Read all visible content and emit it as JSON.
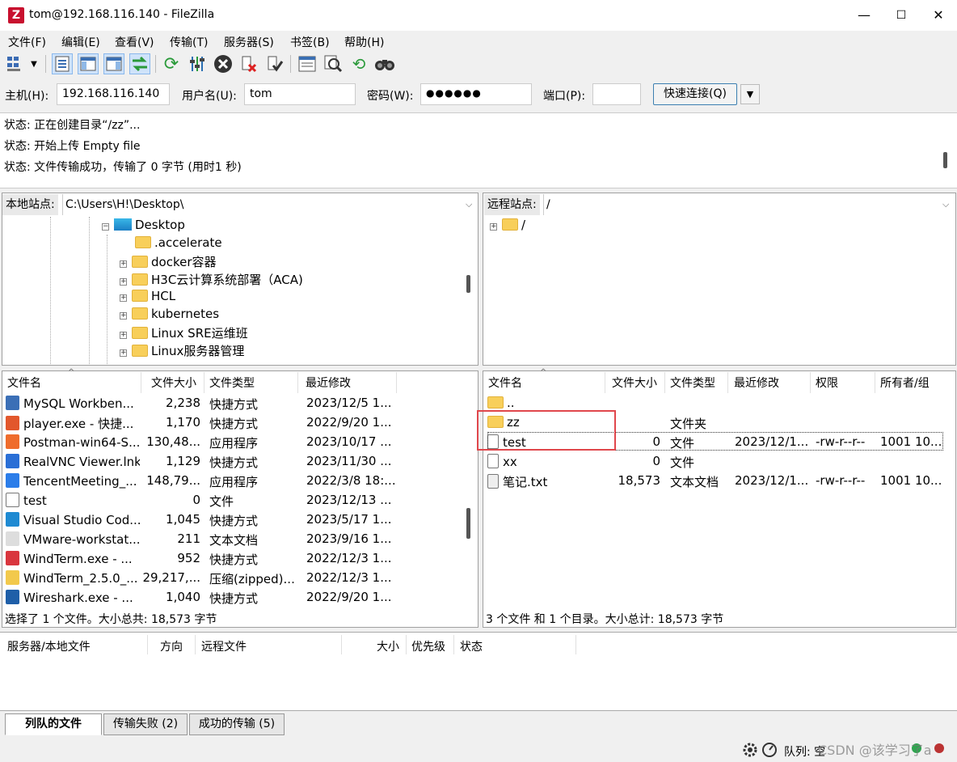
{
  "window": {
    "title": "tom@192.168.116.140 - FileZilla",
    "app_icon_letter": "Z",
    "minimize": "—",
    "maximize": "☐",
    "close": "✕"
  },
  "menu": [
    "文件(F)",
    "编辑(E)",
    "查看(V)",
    "传输(T)",
    "服务器(S)",
    "书签(B)",
    "帮助(H)"
  ],
  "quickconnect": {
    "host_label": "主机(H):",
    "host_value": "192.168.116.140",
    "user_label": "用户名(U):",
    "user_value": "tom",
    "pass_label": "密码(W):",
    "pass_value": "●●●●●●",
    "port_label": "端口(P):",
    "port_value": "",
    "connect_button": "快速连接(Q)",
    "dropdown": "▼"
  },
  "log": [
    "状态:  正在创建目录“/zz”...",
    "状态:  开始上传 Empty file",
    "状态:  文件传输成功，传输了 0 字节 (用时1 秒)"
  ],
  "local": {
    "site_label": "本地站点:",
    "path": "C:\\Users\\H!\\Desktop\\",
    "tree": [
      {
        "name": "Desktop",
        "type": "desktop",
        "expander": "−"
      },
      {
        "name": ".accelerate",
        "type": "folder",
        "expander": ""
      },
      {
        "name": "docker容器",
        "type": "folder",
        "expander": "+"
      },
      {
        "name": "H3C云计算系统部署（ACA)",
        "type": "folder",
        "expander": "+"
      },
      {
        "name": "HCL",
        "type": "folder",
        "expander": "+"
      },
      {
        "name": "kubernetes",
        "type": "folder",
        "expander": "+"
      },
      {
        "name": "Linux SRE运维班",
        "type": "folder",
        "expander": "+"
      },
      {
        "name": "Linux服务器管理",
        "type": "folder",
        "expander": "+"
      }
    ],
    "columns": [
      "文件名",
      "文件大小",
      "文件类型",
      "最近修改"
    ],
    "files": [
      {
        "name": "MySQL Workben...",
        "size": "2,238",
        "type": "快捷方式",
        "modified": "2023/12/5 1...",
        "icon": "#3b6fb6"
      },
      {
        "name": "player.exe - 快捷...",
        "size": "1,170",
        "type": "快捷方式",
        "modified": "2022/9/20 1...",
        "icon": "#e2572c"
      },
      {
        "name": "Postman-win64-S...",
        "size": "130,48...",
        "type": "应用程序",
        "modified": "2023/10/17 ...",
        "icon": "#ef6c2c"
      },
      {
        "name": "RealVNC Viewer.lnk",
        "size": "1,129",
        "type": "快捷方式",
        "modified": "2023/11/30 ...",
        "icon": "#2a6fd6"
      },
      {
        "name": "TencentMeeting_...",
        "size": "148,79...",
        "type": "应用程序",
        "modified": "2022/3/8 18:...",
        "icon": "#2b7de9"
      },
      {
        "name": "test",
        "size": "0",
        "type": "文件",
        "modified": "2023/12/13 ...",
        "icon": "#ffffff"
      },
      {
        "name": "Visual Studio Cod...",
        "size": "1,045",
        "type": "快捷方式",
        "modified": "2023/5/17 1...",
        "icon": "#1f8ad2"
      },
      {
        "name": "VMware-workstat...",
        "size": "211",
        "type": "文本文档",
        "modified": "2023/9/16 1...",
        "icon": "#dddddd"
      },
      {
        "name": "WindTerm.exe - ...",
        "size": "952",
        "type": "快捷方式",
        "modified": "2022/12/3 1...",
        "icon": "#d9363e"
      },
      {
        "name": "WindTerm_2.5.0_...",
        "size": "29,217,...",
        "type": "压缩(zipped)...",
        "modified": "2022/12/3 1...",
        "icon": "#f2c94c"
      },
      {
        "name": "Wireshark.exe - ...",
        "size": "1,040",
        "type": "快捷方式",
        "modified": "2022/9/20 1...",
        "icon": "#1f5fa8"
      }
    ],
    "status": "选择了 1 个文件。大小总共: 18,573 字节"
  },
  "remote": {
    "site_label": "远程站点:",
    "path": "/",
    "tree": [
      {
        "name": "/",
        "expander": "+"
      }
    ],
    "columns": [
      "文件名",
      "文件大小",
      "文件类型",
      "最近修改",
      "权限",
      "所有者/组"
    ],
    "files": [
      {
        "name": "..",
        "size": "",
        "type": "",
        "modified": "",
        "perms": "",
        "owner": "",
        "kind": "folder"
      },
      {
        "name": "zz",
        "size": "",
        "type": "文件夹",
        "modified": "",
        "perms": "",
        "owner": "",
        "kind": "folder"
      },
      {
        "name": "test",
        "size": "0",
        "type": "文件",
        "modified": "2023/12/1...",
        "perms": "-rw-r--r--",
        "owner": "1001 10...",
        "kind": "file"
      },
      {
        "name": "xx",
        "size": "0",
        "type": "文件",
        "modified": "",
        "perms": "",
        "owner": "",
        "kind": "file"
      },
      {
        "name": "笔记.txt",
        "size": "18,573",
        "type": "文本文档",
        "modified": "2023/12/1...",
        "perms": "-rw-r--r--",
        "owner": "1001 10...",
        "kind": "text"
      }
    ],
    "status": "3 个文件 和 1 个目录。大小总计: 18,573 字节"
  },
  "queue": {
    "columns": [
      "服务器/本地文件",
      "方向",
      "远程文件",
      "大小",
      "优先级",
      "状态"
    ]
  },
  "tabs": [
    "列队的文件",
    "传输失败 (2)",
    "成功的传输 (5)"
  ],
  "statusbar": {
    "queue_text": "队列: 空",
    "watermark": "CSDN @该学习了a"
  },
  "colors": {
    "highlight_box": "#e0474c",
    "folder": "#f8cf5a"
  }
}
